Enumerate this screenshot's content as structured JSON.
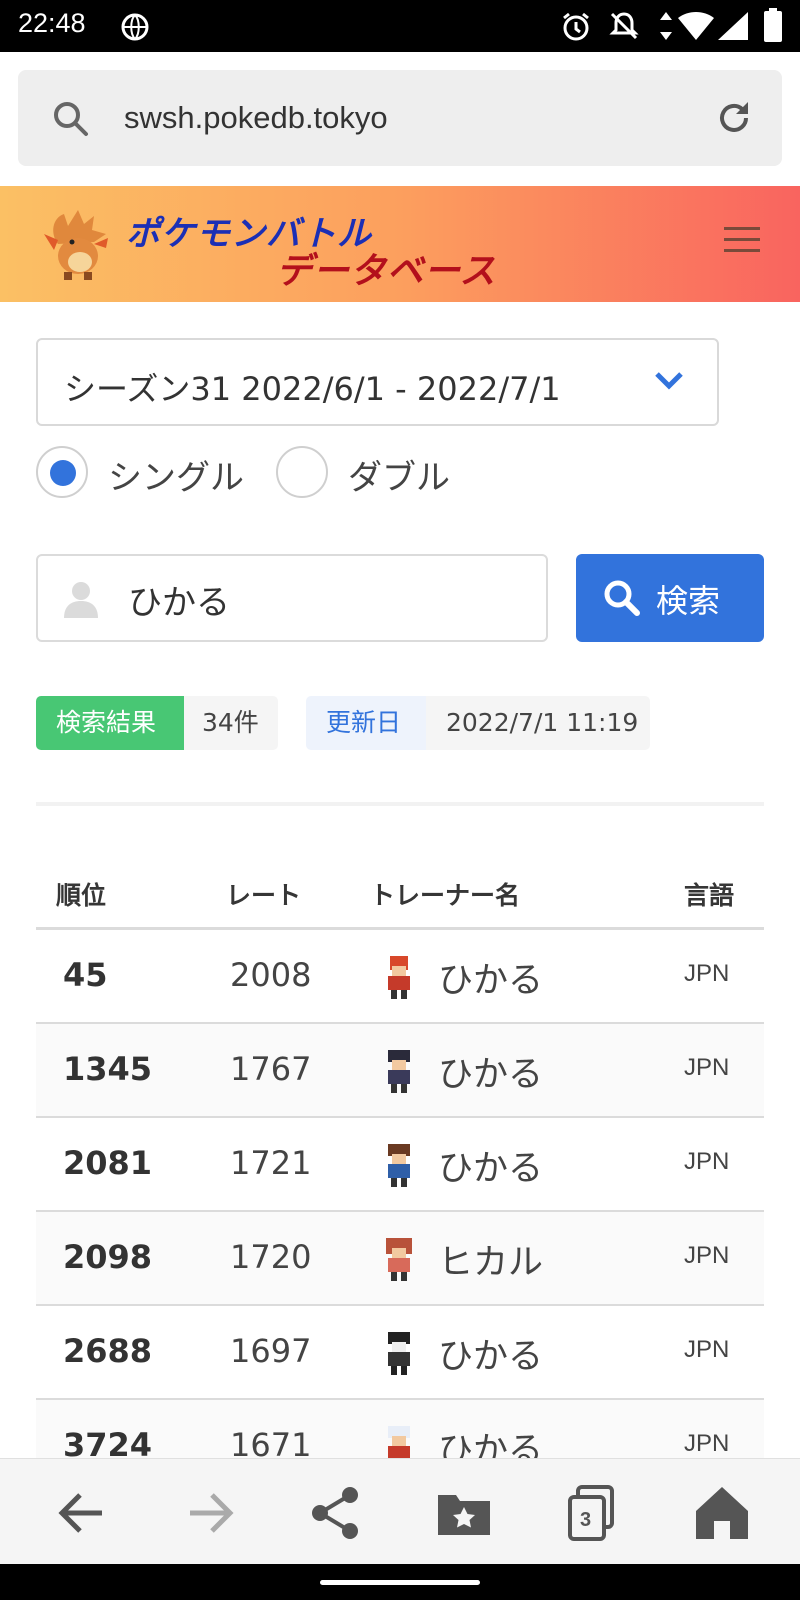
{
  "status_bar": {
    "time": "22:48"
  },
  "browser": {
    "url": "swsh.pokedb.tokyo"
  },
  "site": {
    "logo_line1": "ポケモンバトル",
    "logo_line2": "データベース"
  },
  "controls": {
    "season_selected": "シーズン31  2022/6/1 - 2022/7/1",
    "battle_types": [
      {
        "label": "シングル",
        "selected": true
      },
      {
        "label": "ダブル",
        "selected": false
      }
    ],
    "search_value": "ひかる",
    "search_button": "検索"
  },
  "results": {
    "count_label": "検索結果",
    "count_value": "34件",
    "updated_label": "更新日",
    "updated_value": "2022/7/1 11:19"
  },
  "table": {
    "headers": {
      "rank": "順位",
      "rate": "レート",
      "trainer": "トレーナー名",
      "lang": "言語"
    },
    "rows": [
      {
        "rank": "45",
        "rate": "2008",
        "name": "ひかる",
        "lang": "JPN"
      },
      {
        "rank": "1345",
        "rate": "1767",
        "name": "ひかる",
        "lang": "JPN"
      },
      {
        "rank": "2081",
        "rate": "1721",
        "name": "ひかる",
        "lang": "JPN"
      },
      {
        "rank": "2098",
        "rate": "1720",
        "name": "ヒカル",
        "lang": "JPN"
      },
      {
        "rank": "2688",
        "rate": "1697",
        "name": "ひかる",
        "lang": "JPN"
      },
      {
        "rank": "3724",
        "rate": "1671",
        "name": "ひかる",
        "lang": "JPN"
      }
    ]
  },
  "bottom_nav": {
    "tab_count": "3"
  },
  "colors": {
    "primary": "#3273dc",
    "success": "#48c774",
    "header_start": "#fbc064",
    "header_end": "#f9645f"
  }
}
